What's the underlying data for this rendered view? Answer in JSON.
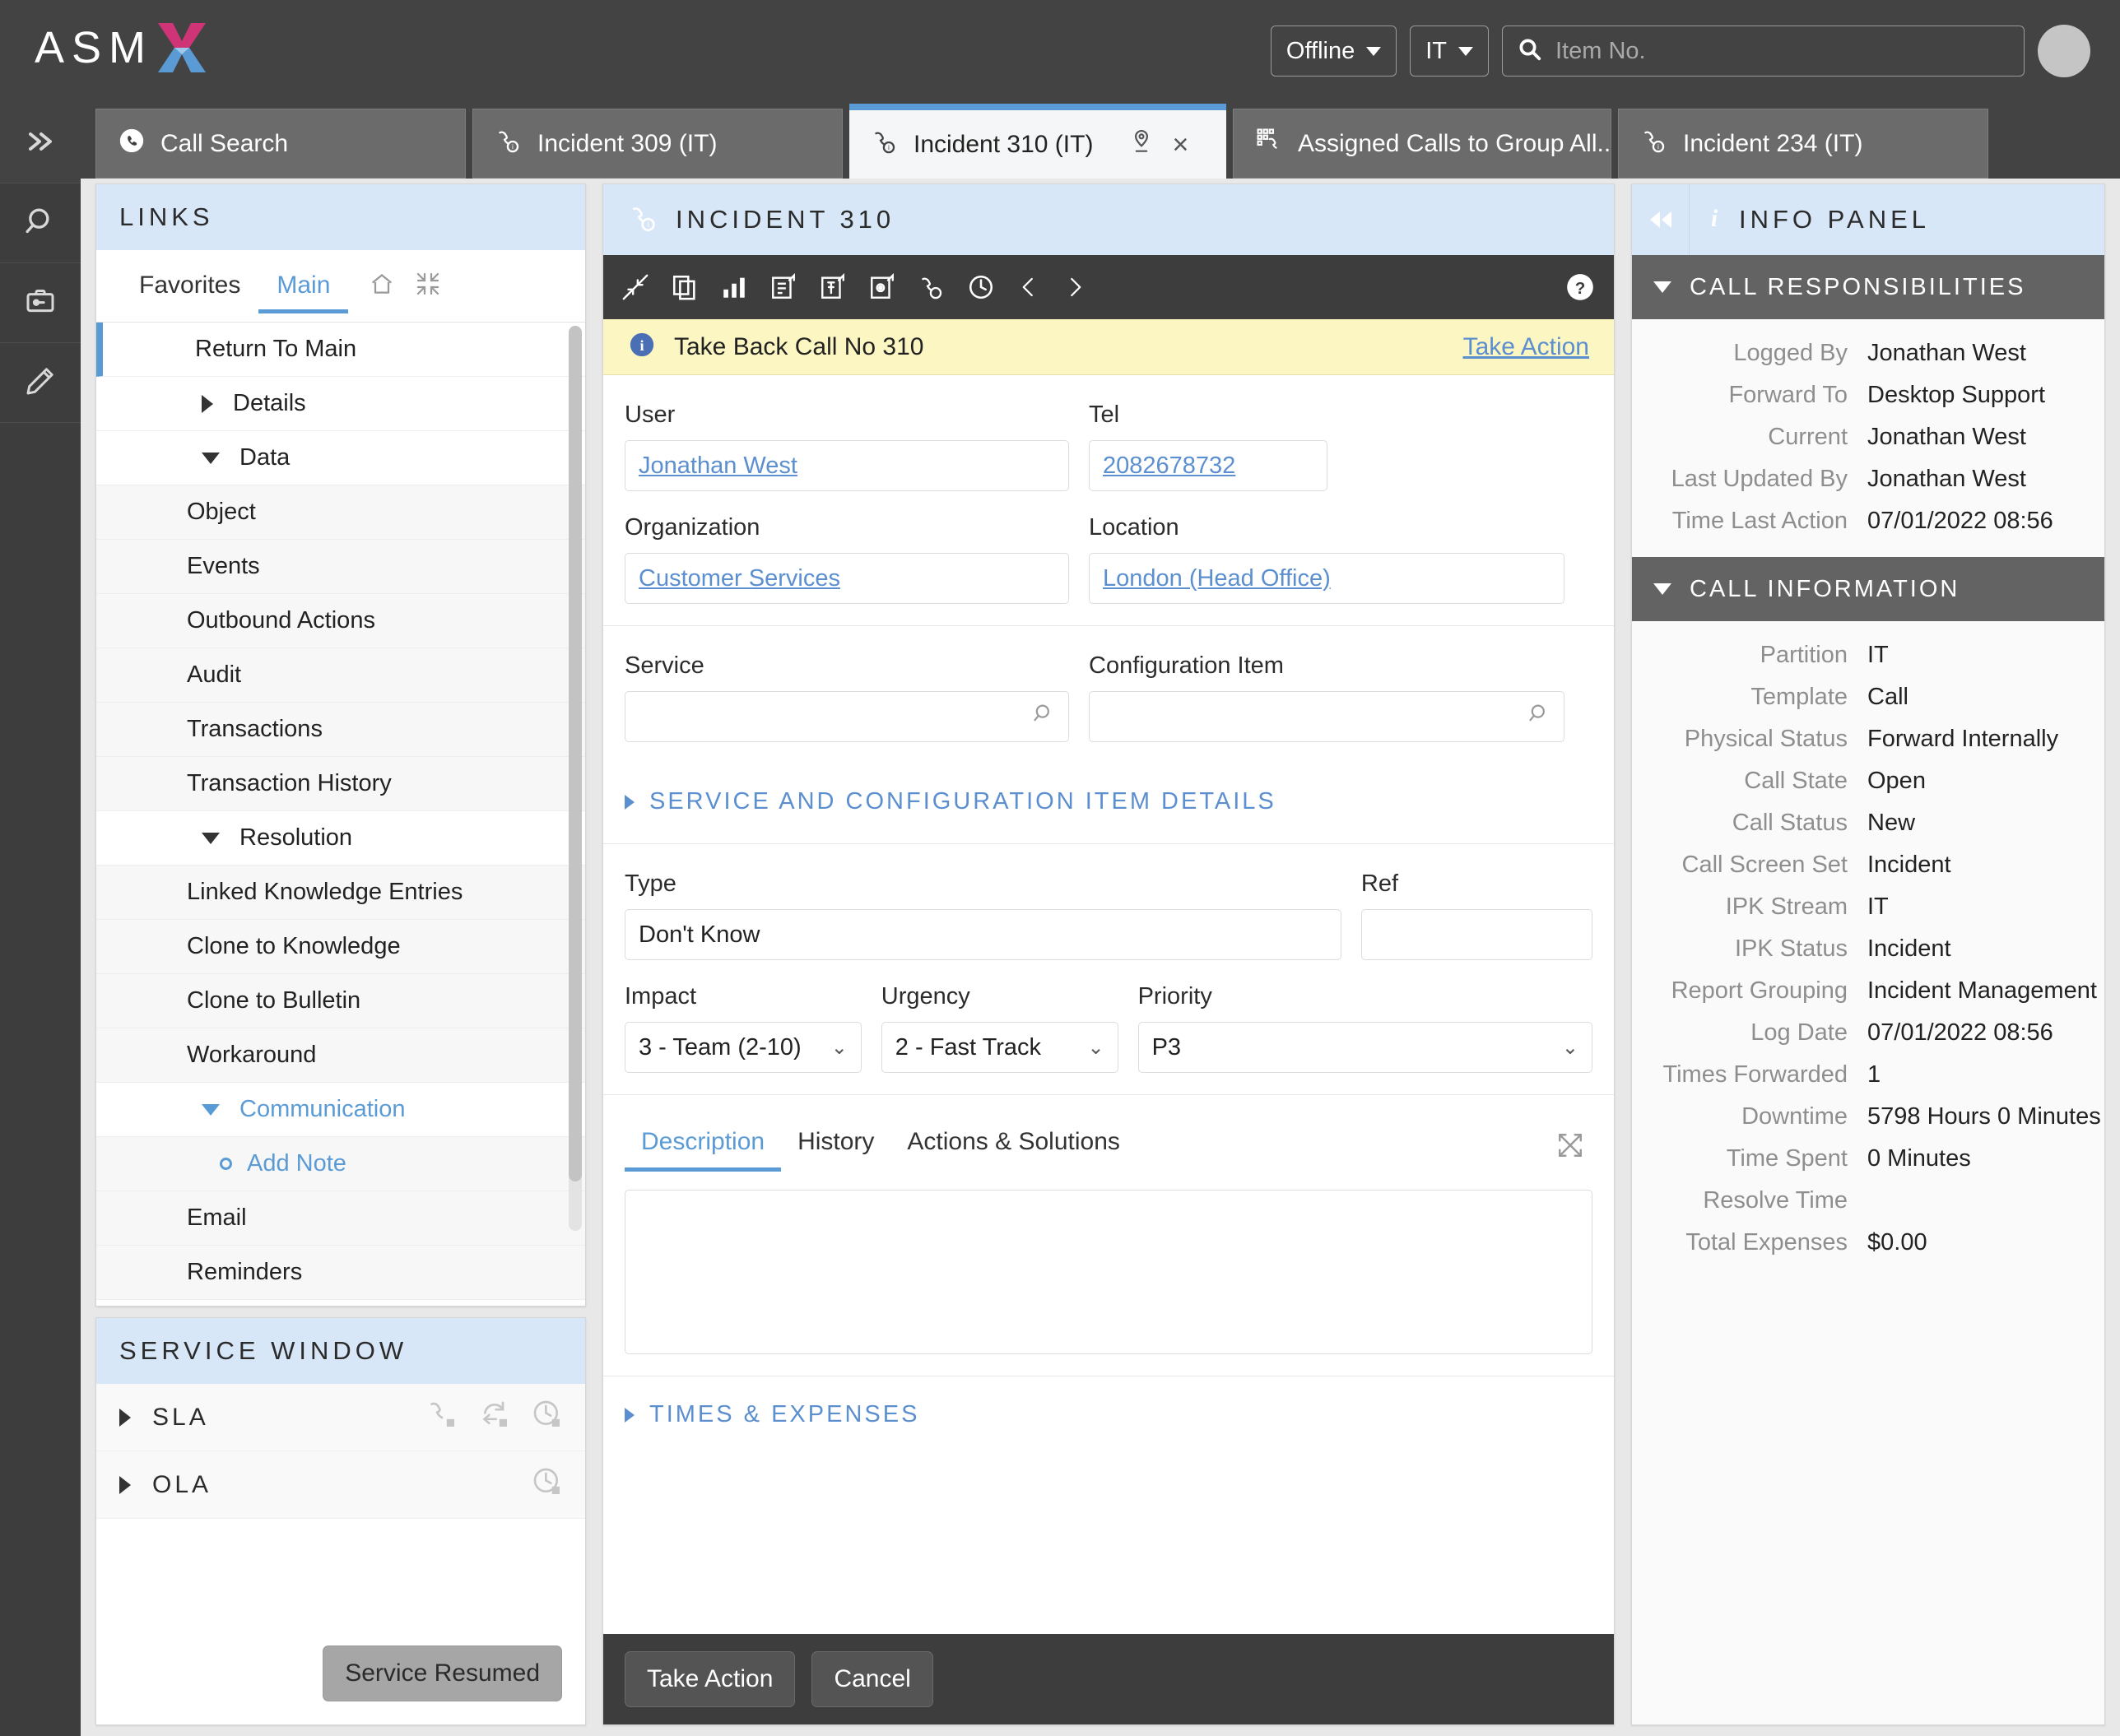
{
  "app": {
    "brand": "ASM",
    "brand_icon": "asm-x-logo"
  },
  "topbar": {
    "status_label": "Offline",
    "partition_label": "IT",
    "search_placeholder": "Item No.",
    "search_value": "",
    "search_icon": "search-icon",
    "avatar": "user-avatar"
  },
  "rail": {
    "items": [
      {
        "name": "expand-rail",
        "icon": "chevron-double-right-icon"
      },
      {
        "name": "search",
        "icon": "magnifier-icon"
      },
      {
        "name": "toolbox",
        "icon": "toolbox-icon"
      },
      {
        "name": "edit",
        "icon": "pencil-icon"
      }
    ]
  },
  "tabs": [
    {
      "label": "Call Search",
      "icon": "phone-circle-icon",
      "active": false
    },
    {
      "label": "Incident 309 (IT)",
      "icon": "incident-phone-icon",
      "active": false
    },
    {
      "label": "Incident 310 (IT)",
      "icon": "incident-phone-icon",
      "active": true,
      "pin_icon": "pin-location-icon",
      "close_icon": "close-icon",
      "close_label": "×"
    },
    {
      "label": "Assigned Calls to Group All...",
      "icon": "grid-phone-icon",
      "active": false
    },
    {
      "label": "Incident 234 (IT)",
      "icon": "incident-phone-icon",
      "active": false
    }
  ],
  "links_panel": {
    "title": "LINKS",
    "subtabs": [
      {
        "label": "Favorites",
        "active": false
      },
      {
        "label": "Main",
        "active": true
      }
    ],
    "subtab_icons": [
      {
        "name": "home-icon"
      },
      {
        "name": "collapse-all-icon"
      }
    ],
    "items": [
      {
        "label": "Return To Main",
        "type": "selected"
      },
      {
        "label": "Details",
        "type": "group",
        "expanded": false
      },
      {
        "label": "Data",
        "type": "group",
        "expanded": true
      },
      {
        "label": "Object",
        "type": "child"
      },
      {
        "label": "Events",
        "type": "child"
      },
      {
        "label": "Outbound Actions",
        "type": "child"
      },
      {
        "label": "Audit",
        "type": "child"
      },
      {
        "label": "Transactions",
        "type": "child"
      },
      {
        "label": "Transaction History",
        "type": "child"
      },
      {
        "label": "Resolution",
        "type": "group",
        "expanded": true
      },
      {
        "label": "Linked Knowledge Entries",
        "type": "child"
      },
      {
        "label": "Clone to Knowledge",
        "type": "child"
      },
      {
        "label": "Clone to Bulletin",
        "type": "child"
      },
      {
        "label": "Workaround",
        "type": "child"
      },
      {
        "label": "Communication",
        "type": "group",
        "expanded": true,
        "highlight": true
      },
      {
        "label": "Add Note",
        "type": "child",
        "bullet": true,
        "highlight": true
      },
      {
        "label": "Email",
        "type": "child"
      },
      {
        "label": "Reminders",
        "type": "child"
      }
    ]
  },
  "service_window": {
    "title": "SERVICE WINDOW",
    "rows": [
      {
        "label": "SLA",
        "icons": [
          "phone-stop-icon",
          "redo-stop-icon",
          "clock-stop-icon"
        ]
      },
      {
        "label": "OLA",
        "icons": [
          "clock-stop-icon"
        ]
      }
    ],
    "button_label": "Service Resumed"
  },
  "incident": {
    "title": "INCIDENT 310",
    "title_icon": "incident-phone-icon",
    "toolbar_icons": [
      "collapse-arrows-icon",
      "copy-icon",
      "bar-chart-icon",
      "document-launch-icon",
      "pin-launch-icon",
      "gear-launch-icon",
      "phone-incident-icon",
      "clock-icon",
      "chevron-left-icon",
      "chevron-right-icon"
    ],
    "help_icon": "help-circle-icon",
    "notice": {
      "icon": "info-icon",
      "text": "Take Back Call No 310",
      "link": "Take Action"
    },
    "fields": {
      "user_label": "User",
      "user_value": "Jonathan West",
      "tel_label": "Tel",
      "tel_value": "2082678732",
      "org_label": "Organization",
      "org_value": "Customer Services",
      "location_label": "Location",
      "location_value": "London (Head Office)",
      "service_label": "Service",
      "service_value": "",
      "ci_label": "Configuration Item",
      "ci_value": "",
      "type_label": "Type",
      "type_value": "Don't Know",
      "ref_label": "Ref",
      "ref_value": "",
      "impact_label": "Impact",
      "impact_value": "3 - Team (2-10)",
      "urgency_label": "Urgency",
      "urgency_value": "2 - Fast Track",
      "priority_label": "Priority",
      "priority_value": "P3"
    },
    "service_details_section": "SERVICE AND CONFIGURATION ITEM DETAILS",
    "times_expenses_section": "TIMES & EXPENSES",
    "content_tabs": [
      {
        "label": "Description",
        "active": true
      },
      {
        "label": "History",
        "active": false
      },
      {
        "label": "Actions & Solutions",
        "active": false
      }
    ],
    "description_value": "",
    "expand_icon": "expand-diagonal-icon",
    "footer_buttons": [
      {
        "label": "Take Action",
        "name": "take-action-button"
      },
      {
        "label": "Cancel",
        "name": "cancel-button"
      }
    ]
  },
  "info_panel": {
    "title": "INFO PANEL",
    "title_icon": "info-italic-icon",
    "collapse_icon": "collapse-right-panel-icon",
    "sections": [
      {
        "title": "CALL RESPONSIBILITIES",
        "rows": [
          {
            "key": "Logged By",
            "value": "Jonathan West"
          },
          {
            "key": "Forward To",
            "value": "Desktop Support"
          },
          {
            "key": "Current",
            "value": "Jonathan West"
          },
          {
            "key": "Last Updated By",
            "value": "Jonathan West"
          },
          {
            "key": "Time Last Action",
            "value": "07/01/2022 08:56"
          }
        ]
      },
      {
        "title": "CALL INFORMATION",
        "rows": [
          {
            "key": "Partition",
            "value": "IT"
          },
          {
            "key": "Template",
            "value": "Call"
          },
          {
            "key": "Physical Status",
            "value": "Forward Internally"
          },
          {
            "key": "Call State",
            "value": "Open"
          },
          {
            "key": "Call Status",
            "value": "New"
          },
          {
            "key": "Call Screen Set",
            "value": "Incident"
          },
          {
            "key": "IPK Stream",
            "value": "IT"
          },
          {
            "key": "IPK Status",
            "value": "Incident"
          },
          {
            "key": "Report Grouping",
            "value": "Incident Management"
          },
          {
            "key": "Log Date",
            "value": "07/01/2022 08:56"
          },
          {
            "key": "Times Forwarded",
            "value": "1"
          },
          {
            "key": "Downtime",
            "value": "5798 Hours 0 Minutes"
          },
          {
            "key": "Time Spent",
            "value": "0 Minutes"
          },
          {
            "key": "Resolve Time",
            "value": ""
          },
          {
            "key": "Total Expenses",
            "value": "$0.00"
          }
        ]
      }
    ]
  },
  "colors": {
    "accent": "#5b9bd5",
    "link": "#5b8fd0",
    "panel_header_bg": "#d7e7f7",
    "dark_bar": "#3d3d3d",
    "notice_bg": "#fbf6c2",
    "logo_pink": "#cf3576",
    "logo_blue": "#5b9bd5"
  }
}
